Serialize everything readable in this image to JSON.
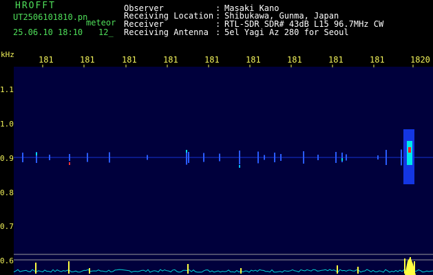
{
  "brand": "HROFFT",
  "filename": "UT2506101810.pn",
  "mode": "meteor",
  "datetime": "25.06.10 18:10",
  "count": "12_",
  "header": [
    {
      "label": "Observer",
      "value": "Masaki Kano"
    },
    {
      "label": "Receiving Location",
      "value": "Shibukawa, Gunma, Japan"
    },
    {
      "label": "Receiver",
      "value": "RTL-SDR SDR# 43dB L15 96.7MHz CW"
    },
    {
      "label": "Receiving Antenna",
      "value": "5el Yagi Az 280 for Seoul"
    }
  ],
  "axis": {
    "unit": "kHz",
    "time_ticks": [
      "181",
      "181",
      "181",
      "181",
      "181",
      "181",
      "181",
      "181",
      "181",
      "1820"
    ],
    "freq_ticks": [
      "1.1",
      "1.0",
      "0.9",
      "0.8",
      "0.7",
      "0.6"
    ]
  },
  "colors": {
    "background": "#000000",
    "label_green": "#4fe05a",
    "tick_yellow": "#f2f25a",
    "plot_bg": "#00003c",
    "signal_line": "#2a5cff",
    "baseline_line": "#9a9a9a",
    "spectrum_cyan": "#00d8d8",
    "spectrum_yellow": "#ffff40"
  }
}
